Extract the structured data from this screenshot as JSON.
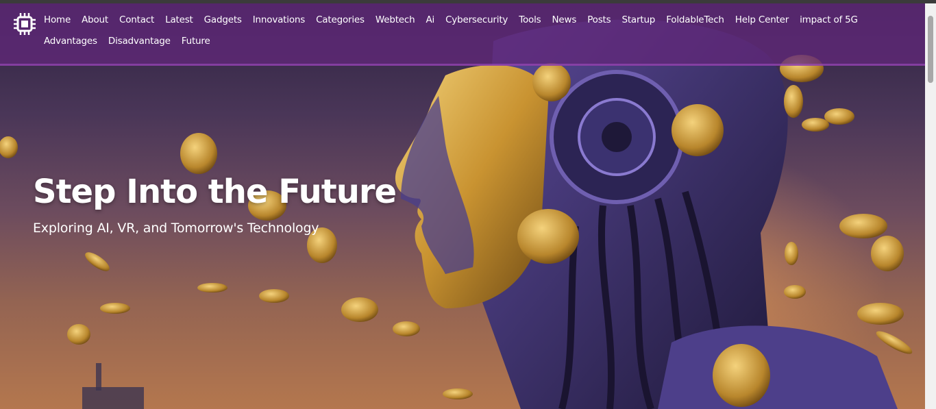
{
  "nav": {
    "links": [
      {
        "label": "Home"
      },
      {
        "label": "About"
      },
      {
        "label": "Contact"
      },
      {
        "label": "Latest"
      },
      {
        "label": "Gadgets"
      },
      {
        "label": "Innovations"
      },
      {
        "label": "Categories"
      },
      {
        "label": "Webtech"
      },
      {
        "label": "Ai"
      },
      {
        "label": "Cybersecurity"
      },
      {
        "label": "Tools"
      },
      {
        "label": "News"
      },
      {
        "label": "Posts"
      },
      {
        "label": "Startup"
      },
      {
        "label": "FoldableTech"
      },
      {
        "label": "Help Center"
      },
      {
        "label": "impact of 5G"
      },
      {
        "label": "Advantages"
      },
      {
        "label": "Disadvantage"
      },
      {
        "label": "Future"
      }
    ]
  },
  "hero": {
    "title": "Step Into the Future",
    "subtitle": "Exploring AI, VR, and Tomorrow's Technology"
  },
  "icons": {
    "logo": "chip-icon"
  },
  "colors": {
    "navbar": "#602878",
    "navbar_border": "#aa50c8",
    "text": "#ffffff"
  }
}
